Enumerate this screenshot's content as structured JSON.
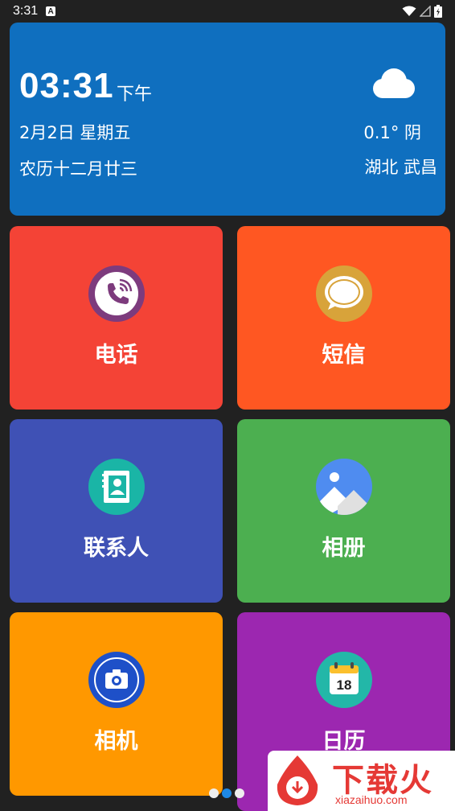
{
  "status_bar": {
    "time": "3:31",
    "notification_icon": "A"
  },
  "weather_card": {
    "time": "03:31",
    "ampm": "下午",
    "date": "2月2日 星期五",
    "lunar": "农历十二月廿三",
    "temperature": "0.1° 阴",
    "location": "湖北 武昌",
    "weather_icon": "cloud-icon"
  },
  "tiles": [
    {
      "label": "电话",
      "icon": "phone-icon",
      "color": "#f44336"
    },
    {
      "label": "短信",
      "icon": "message-icon",
      "color": "#ff5722"
    },
    {
      "label": "联系人",
      "icon": "contacts-icon",
      "color": "#3f51b5"
    },
    {
      "label": "相册",
      "icon": "gallery-icon",
      "color": "#4caf50"
    },
    {
      "label": "相机",
      "icon": "camera-icon",
      "color": "#ff9800"
    },
    {
      "label": "日历",
      "icon": "calendar-icon",
      "color": "#9c27b0",
      "calendar_day": "18"
    }
  ],
  "page_indicator": {
    "pages": 3,
    "active": 2
  },
  "watermark": {
    "title": "下载火",
    "site": "xiazaihuo.com"
  }
}
